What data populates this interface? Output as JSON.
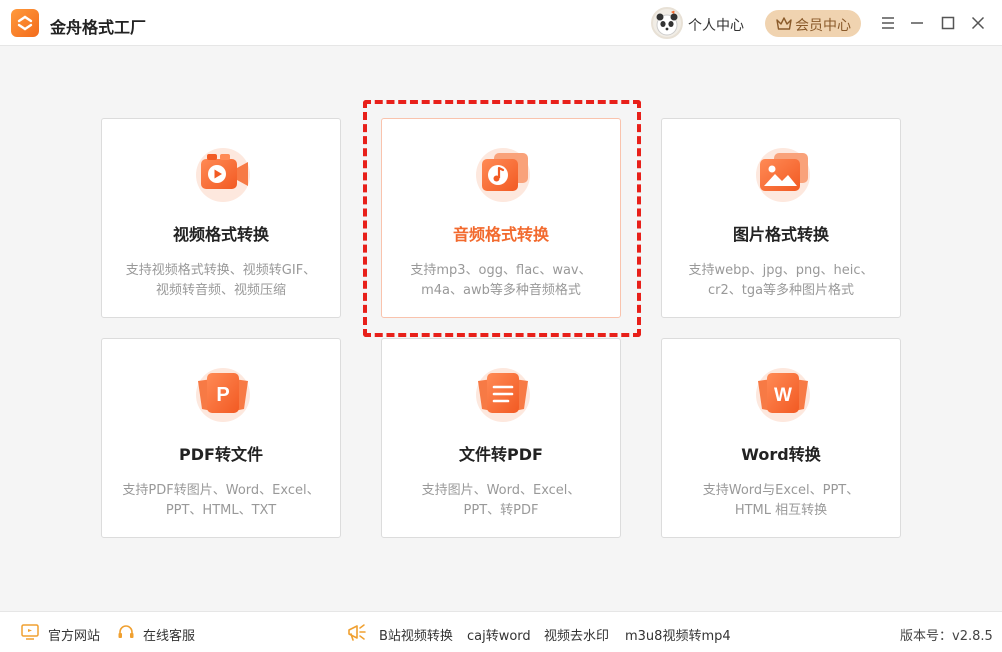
{
  "app": {
    "title": "金舟格式工厂",
    "accent": "#f26a2e",
    "highlight": "#e8201a"
  },
  "header": {
    "personal_center": "个人中心",
    "vip_center": "会员中心",
    "icons": [
      "menu-icon",
      "minimize-icon",
      "maximize-icon",
      "close-icon"
    ]
  },
  "cards": [
    {
      "title": "视频格式转换",
      "desc1": "支持视频格式转换、视频转GIF、",
      "desc2": "视频转音频、视频压缩",
      "icon": "video-icon"
    },
    {
      "title": "音频格式转换",
      "desc1": "支持mp3、ogg、flac、wav、",
      "desc2": "m4a、awb等多种音频格式",
      "icon": "audio-icon",
      "selected": true
    },
    {
      "title": "图片格式转换",
      "desc1": "支持webp、jpg、png、heic、",
      "desc2": "cr2、tga等多种图片格式",
      "icon": "image-icon"
    },
    {
      "title": "PDF转文件",
      "desc1": "支持PDF转图片、Word、Excel、",
      "desc2": "PPT、HTML、TXT",
      "icon": "pdf-icon"
    },
    {
      "title": "文件转PDF",
      "desc1": "支持图片、Word、Excel、",
      "desc2": "PPT、转PDF",
      "icon": "file-icon"
    },
    {
      "title": "Word转换",
      "desc1": "支持Word与Excel、PPT、",
      "desc2": "HTML 相互转换",
      "icon": "word-icon"
    }
  ],
  "footer": {
    "official_site": "官方网站",
    "online_service": "在线客服",
    "links": [
      "B站视频转换",
      "caj转word",
      "视频去水印",
      "m3u8视频转mp4"
    ],
    "version": "版本号：v2.8.5"
  }
}
